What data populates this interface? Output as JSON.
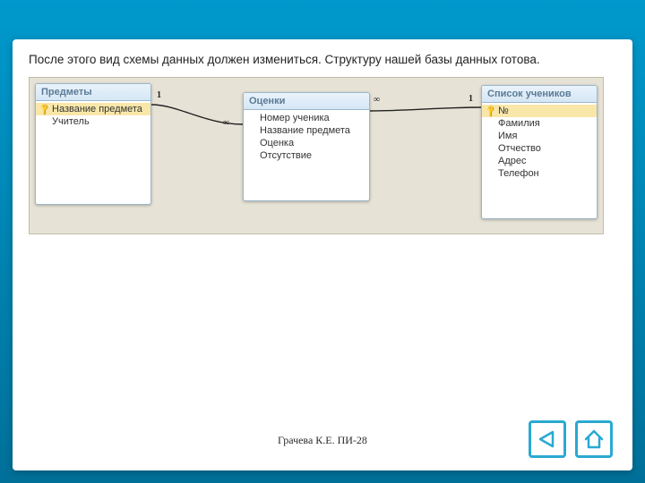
{
  "caption": "После этого вид схемы данных должен измениться. Структуру нашей базы данных готова.",
  "footer": "Грачева К.Е. ПИ-28",
  "colors": {
    "accent": "#2aa9d2",
    "header_text": "#5b7a96",
    "pk_bg": "#f9e7a9"
  },
  "schema": {
    "tables": {
      "predmety": {
        "title": "Предметы",
        "fields": [
          {
            "label": "Название предмета",
            "pk": true
          },
          {
            "label": "Учитель",
            "pk": false
          }
        ]
      },
      "ocenki": {
        "title": "Оценки",
        "fields": [
          {
            "label": "Номер ученика",
            "pk": false
          },
          {
            "label": "Название предмета",
            "pk": false
          },
          {
            "label": "Оценка",
            "pk": false
          },
          {
            "label": "Отсутствие",
            "pk": false
          }
        ]
      },
      "spisok": {
        "title": "Список учеников",
        "fields": [
          {
            "label": "№",
            "pk": true
          },
          {
            "label": "Фамилия",
            "pk": false
          },
          {
            "label": "Имя",
            "pk": false
          },
          {
            "label": "Отчество",
            "pk": false
          },
          {
            "label": "Адрес",
            "pk": false
          },
          {
            "label": "Телефон",
            "pk": false
          }
        ]
      }
    },
    "relations": {
      "r1": {
        "left_card": "1",
        "right_card": "∞"
      },
      "r2": {
        "left_card": "∞",
        "right_card": "1"
      }
    }
  },
  "nav": {
    "prev_name": "back-icon",
    "home_name": "home-icon"
  }
}
